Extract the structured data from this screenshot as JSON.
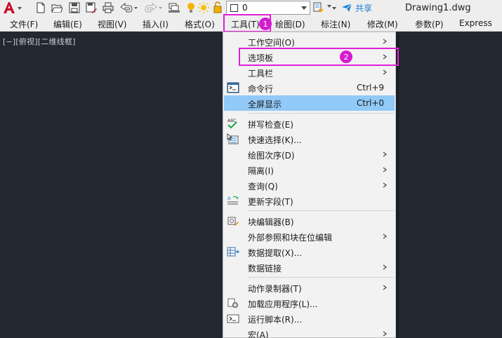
{
  "toolbar": {
    "layer_value": "0",
    "share_label": "共享",
    "document_title": "Drawing1.dwg"
  },
  "menubar": {
    "items": [
      {
        "label": "文件(F)"
      },
      {
        "label": "编辑(E)"
      },
      {
        "label": "视图(V)"
      },
      {
        "label": "插入(I)"
      },
      {
        "label": "格式(O)"
      },
      {
        "label": "工具(T)"
      },
      {
        "label": "绘图(D)"
      },
      {
        "label": "标注(N)"
      },
      {
        "label": "修改(M)"
      },
      {
        "label": "参数(P)"
      },
      {
        "label": "Express"
      }
    ]
  },
  "viewport": {
    "label": "[−][俯视][二维线框]"
  },
  "annotations": {
    "badge_1": "1",
    "badge_2": "2"
  },
  "tools_menu": {
    "items": [
      {
        "label": "工作空间(O)",
        "submenu": true
      },
      {
        "label": "选项板",
        "submenu": true
      },
      {
        "label": "工具栏",
        "submenu": true
      },
      {
        "label": "命令行",
        "shortcut": "Ctrl+9",
        "icon": "command-line-icon"
      },
      {
        "label": "全屏显示",
        "shortcut": "Ctrl+0",
        "highlighted": true
      },
      {
        "label": "拼写检查(E)",
        "icon": "spell-check-icon"
      },
      {
        "label": "快速选择(K)...",
        "icon": "quick-select-icon"
      },
      {
        "label": "绘图次序(D)",
        "submenu": true
      },
      {
        "label": "隔离(I)",
        "submenu": true
      },
      {
        "label": "查询(Q)",
        "submenu": true
      },
      {
        "label": "更新字段(T)",
        "icon": "update-field-icon"
      },
      {
        "label": "块编辑器(B)",
        "icon": "block-editor-icon"
      },
      {
        "label": "外部参照和块在位编辑",
        "submenu": true
      },
      {
        "label": "数据提取(X)...",
        "icon": "data-extraction-icon"
      },
      {
        "label": "数据链接",
        "submenu": true
      },
      {
        "label": "动作录制器(T)",
        "submenu": true
      },
      {
        "label": "加载应用程序(L)...",
        "icon": "load-application-icon"
      },
      {
        "label": "运行脚本(R)...",
        "icon": "run-script-icon"
      },
      {
        "label": "宏(A)",
        "submenu": true
      }
    ]
  },
  "colors": {
    "drawing_background": "#212830",
    "menu_highlight": "#91c9f7",
    "annotation_magenta": "#e01fd6",
    "app_logo_red": "#c8102e"
  }
}
